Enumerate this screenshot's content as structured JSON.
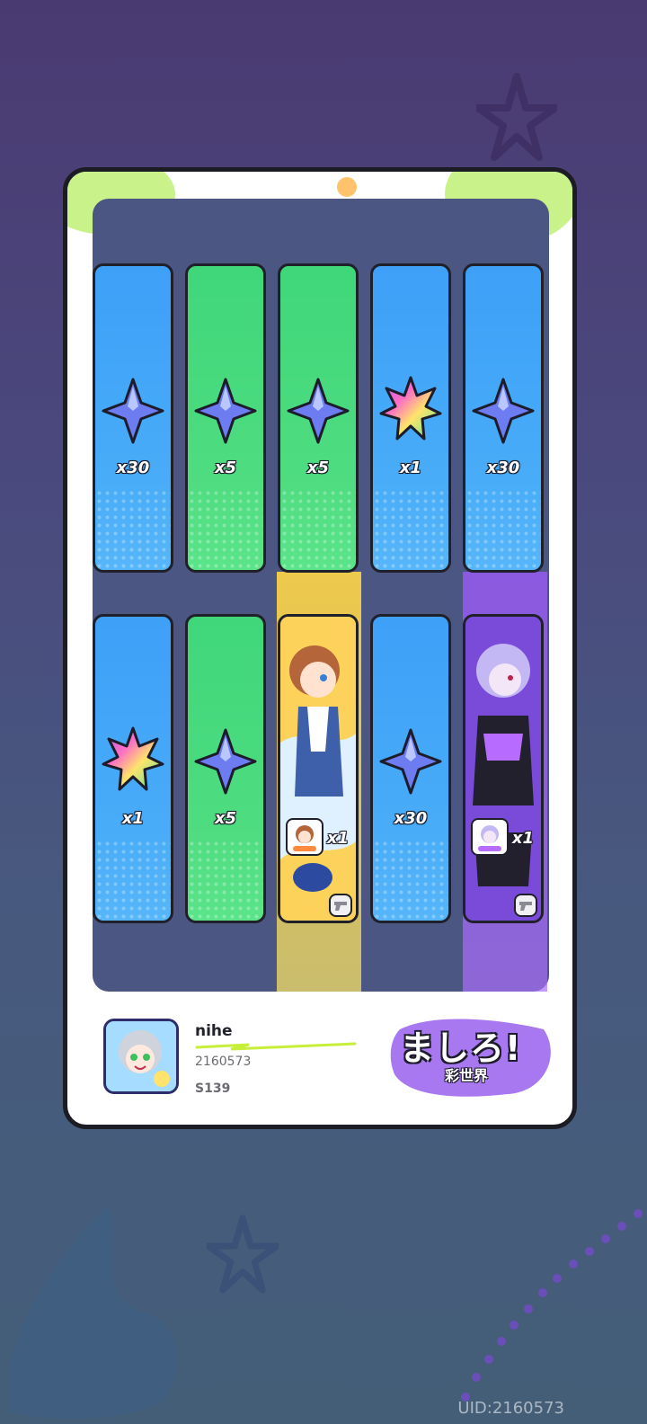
{
  "colors": {
    "blue_card": "#3ea0f7",
    "green_card": "#3fd77a",
    "purple_card": "#7348d8",
    "yellow_card": "#fdd25a",
    "board": "#4c5682"
  },
  "rewards": [
    {
      "type": "blue",
      "icon": "blue-star-crystal-icon",
      "qty": "x30"
    },
    {
      "type": "green",
      "icon": "blue-star-crystal-icon",
      "qty": "x5"
    },
    {
      "type": "green",
      "icon": "blue-star-crystal-icon",
      "qty": "x5"
    },
    {
      "type": "blue",
      "icon": "rainbow-leaf-crystal-icon",
      "qty": "x1"
    },
    {
      "type": "blue",
      "icon": "blue-star-crystal-icon",
      "qty": "x30"
    },
    {
      "type": "blue",
      "icon": "rainbow-leaf-crystal-icon",
      "qty": "x1"
    },
    {
      "type": "green",
      "icon": "blue-star-crystal-icon",
      "qty": "x5"
    },
    {
      "type": "yellow",
      "icon": "character-portrait",
      "qty": "x1"
    },
    {
      "type": "blue",
      "icon": "blue-star-crystal-icon",
      "qty": "x30"
    },
    {
      "type": "purple",
      "icon": "character-portrait",
      "qty": "x1"
    }
  ],
  "player": {
    "name": "nihe",
    "id": "2160573",
    "server": "S139"
  },
  "logo": {
    "title": "ましろ!",
    "subtitle": "彩世界"
  },
  "uid_label": "UID:2160573"
}
